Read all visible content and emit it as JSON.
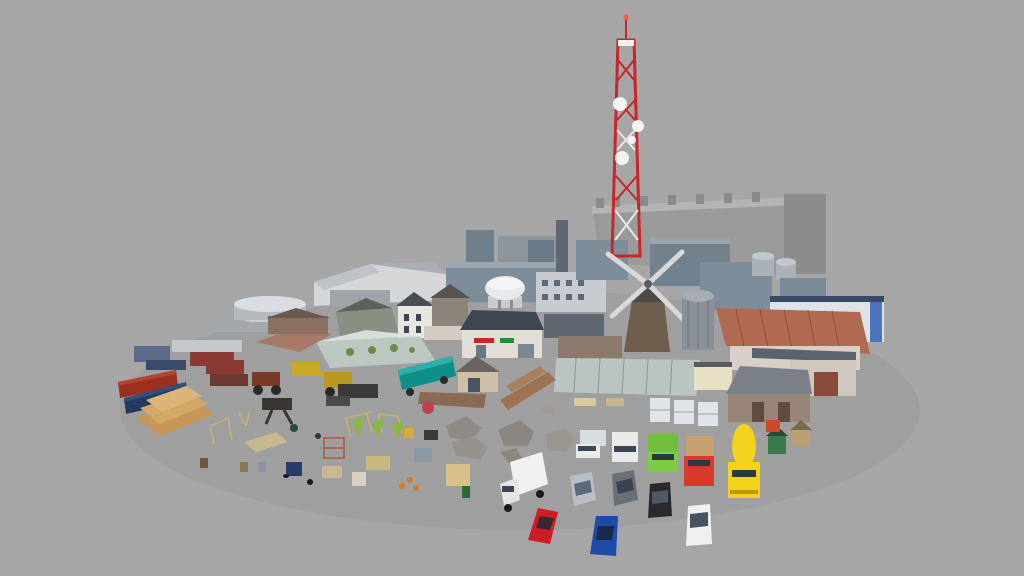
{
  "scene": {
    "background": "#a6a6a6",
    "colors": {
      "tower_red": "#c8262a",
      "tower_white": "#f2f2f2",
      "castle_stone": "#9a9a98",
      "factory_blue": "#7d8c99",
      "roof_rust": "#b06a52",
      "greenhouse": "#bcc8c4",
      "teal_trailer": "#0f8f8a",
      "container_red": "#9c3020",
      "container_navy": "#243a5e",
      "lumber": "#d2a866",
      "truck_green": "#6fbf3a",
      "truck_red": "#d93a2c",
      "truck_yellow": "#f2d21a",
      "car_red": "#d01c24",
      "car_blue": "#1f4aa8",
      "car_silver": "#b8bec4",
      "car_black": "#2a2a2e",
      "car_white": "#f0f0f0"
    }
  }
}
